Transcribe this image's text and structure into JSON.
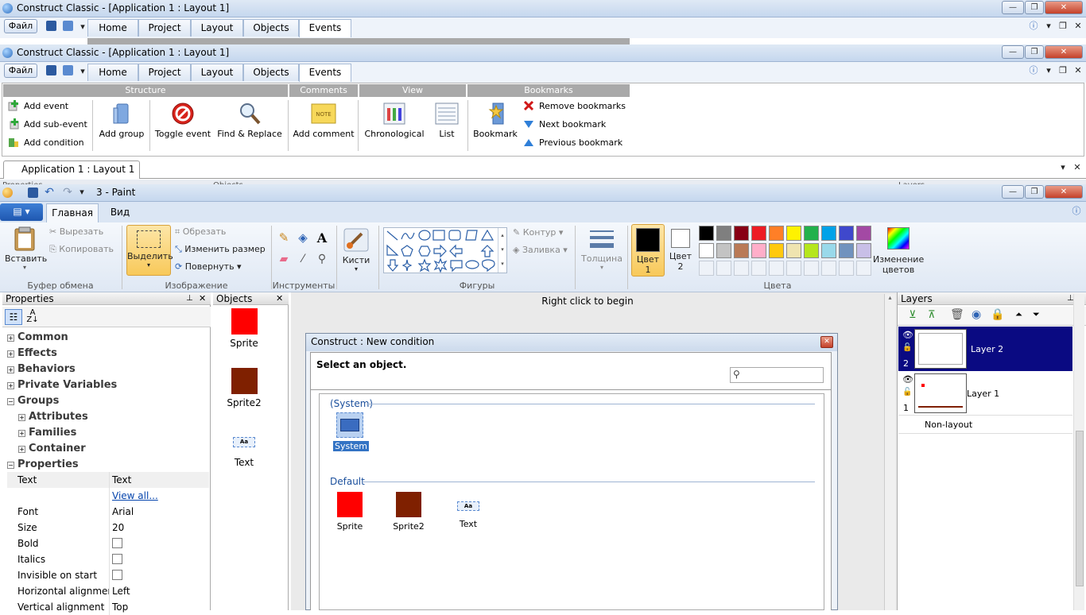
{
  "construct_window_back": {
    "title": "Construct Classic - [Application 1 : Layout 1]",
    "file_label": "Файл",
    "tabs": [
      "Home",
      "Project",
      "Layout",
      "Objects",
      "Events"
    ]
  },
  "construct_window": {
    "title": "Construct Classic - [Application 1 : Layout 1]",
    "file_label": "Файл",
    "tabs": [
      "Home",
      "Project",
      "Layout",
      "Objects",
      "Events"
    ],
    "selected_tab": "Events",
    "groups": [
      "Structure",
      "Comments",
      "View",
      "Bookmarks"
    ],
    "ribbon": {
      "add_event": "Add event",
      "add_sub_event": "Add sub-event",
      "add_condition": "Add condition",
      "add_group": "Add group",
      "toggle_event": "Toggle event",
      "find_replace": "Find & Replace",
      "add_comment": "Add comment",
      "note_label": "NOTE",
      "chronological": "Chronological",
      "list": "List",
      "bookmark": "Bookmark",
      "remove_bookmarks": "Remove bookmarks",
      "next_bookmark": "Next bookmark",
      "previous_bookmark": "Previous bookmark"
    },
    "doc_tab": "Application 1 : Layout 1",
    "hidden_panels": [
      "Properties",
      "Objects",
      "Layers"
    ]
  },
  "paint": {
    "title": "3 - Paint",
    "tabs": [
      "Главная",
      "Вид"
    ],
    "selected_tab": "Главная",
    "clipboard": {
      "paste": "Вставить",
      "cut": "Вырезать",
      "copy": "Копировать",
      "group": "Буфер обмена"
    },
    "image": {
      "select": "Выделить",
      "crop": "Обрезать",
      "resize": "Изменить размер",
      "rotate": "Повернуть",
      "group": "Изображение"
    },
    "tools_group": "Инструменты",
    "brushes": "Кисти",
    "shapes_group": "Фигуры",
    "outline": "Контур",
    "fill": "Заливка",
    "thickness": "Толщина",
    "color1": [
      "Цвет",
      "1"
    ],
    "color2": [
      "Цвет",
      "2"
    ],
    "colors_group": "Цвета",
    "edit_colors": [
      "Изменение",
      "цветов"
    ],
    "palette_row1": [
      "#000000",
      "#7f7f7f",
      "#880015",
      "#ed1c24",
      "#ff7f27",
      "#fff200",
      "#22b14c",
      "#00a2e8",
      "#3f48cc",
      "#a349a4"
    ],
    "palette_row2": [
      "#ffffff",
      "#c3c3c3",
      "#b97a57",
      "#ffaec9",
      "#ffc90e",
      "#efe4b0",
      "#b5e61d",
      "#99d9ea",
      "#7092be",
      "#c8bfe7"
    ]
  },
  "properties_panel": {
    "title": "Properties",
    "categories": [
      "Common",
      "Effects",
      "Behaviors",
      "Private Variables",
      "Groups"
    ],
    "subcategories": [
      "Attributes",
      "Families",
      "Container"
    ],
    "properties_header": "Properties",
    "rows": [
      {
        "key": "Text",
        "value": "Text"
      },
      {
        "key": "",
        "value": "View all..."
      },
      {
        "key": "Font",
        "value": "Arial"
      },
      {
        "key": "Size",
        "value": "20"
      },
      {
        "key": "Bold",
        "value": ""
      },
      {
        "key": "Italics",
        "value": ""
      },
      {
        "key": "Invisible on start",
        "value": ""
      },
      {
        "key": "Horizontal alignment",
        "value": "Left"
      },
      {
        "key": "Vertical alignment",
        "value": "Top"
      }
    ]
  },
  "objects_panel": {
    "title": "Objects",
    "items": [
      {
        "label": "Sprite",
        "color": "#ff0000"
      },
      {
        "label": "Sprite2",
        "color": "#7f2000"
      },
      {
        "label": "Text",
        "color": ""
      }
    ]
  },
  "canvas": {
    "hint": "Right click to begin"
  },
  "dialog": {
    "title": "Construct : New condition",
    "prompt": "Select an object.",
    "search_placeholder": "",
    "system_group": "(System)",
    "system_item": "System",
    "default_group": "Default",
    "items": [
      {
        "label": "Sprite",
        "color": "#ff0000"
      },
      {
        "label": "Sprite2",
        "color": "#7f2000"
      },
      {
        "label": "Text",
        "color": ""
      }
    ],
    "text_icon_label": "Aa"
  },
  "layers_panel": {
    "title": "Layers",
    "layers": [
      {
        "name": "Layer 2",
        "num": "2",
        "selected": true
      },
      {
        "name": "Layer 1",
        "num": "1",
        "selected": false
      }
    ],
    "non_layout": "Non-layout"
  }
}
